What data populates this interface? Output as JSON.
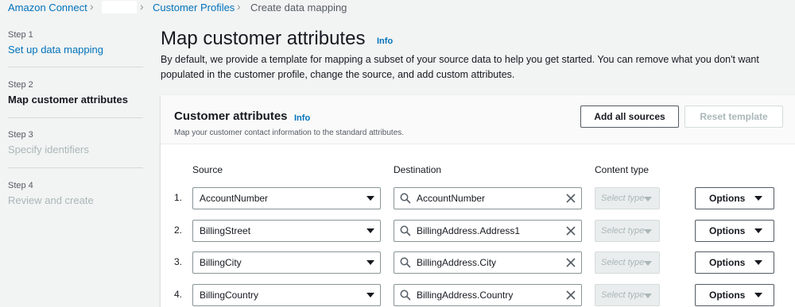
{
  "breadcrumb": {
    "items": [
      "Amazon Connect",
      "Customer Profiles",
      "Create data mapping"
    ]
  },
  "steps": [
    {
      "number": "Step 1",
      "title": "Set up data mapping",
      "state": "link"
    },
    {
      "number": "Step 2",
      "title": "Map customer attributes",
      "state": "current"
    },
    {
      "number": "Step 3",
      "title": "Specify identifiers",
      "state": "disabled"
    },
    {
      "number": "Step 4",
      "title": "Review and create",
      "state": "disabled"
    }
  ],
  "header": {
    "title": "Map customer attributes",
    "info": "Info",
    "description": "By default, we provide a template for mapping a subset of your source data to help you get started. You can remove what you don't want populated in the customer profile, change the source, and add custom attributes."
  },
  "container": {
    "title": "Customer attributes",
    "info": "Info",
    "description": "Map your customer contact information to the standard attributes.",
    "add_all_label": "Add all sources",
    "reset_label": "Reset template",
    "columns": {
      "source": "Source",
      "destination": "Destination",
      "content_type": "Content type"
    },
    "rows": [
      {
        "num": "1.",
        "source": "AccountNumber",
        "destination": "AccountNumber",
        "content_type": "Select type",
        "options": "Options"
      },
      {
        "num": "2.",
        "source": "BillingStreet",
        "destination": "BillingAddress.Address1",
        "content_type": "Select type",
        "options": "Options"
      },
      {
        "num": "3.",
        "source": "BillingCity",
        "destination": "BillingAddress.City",
        "content_type": "Select type",
        "options": "Options"
      },
      {
        "num": "4.",
        "source": "BillingCountry",
        "destination": "BillingAddress.Country",
        "content_type": "Select type",
        "options": "Options"
      }
    ]
  },
  "colors": {
    "link": "#0073bb",
    "text": "#16191f",
    "muted": "#545b64",
    "disabled": "#aab7b8",
    "background": "#f2f3f3"
  }
}
